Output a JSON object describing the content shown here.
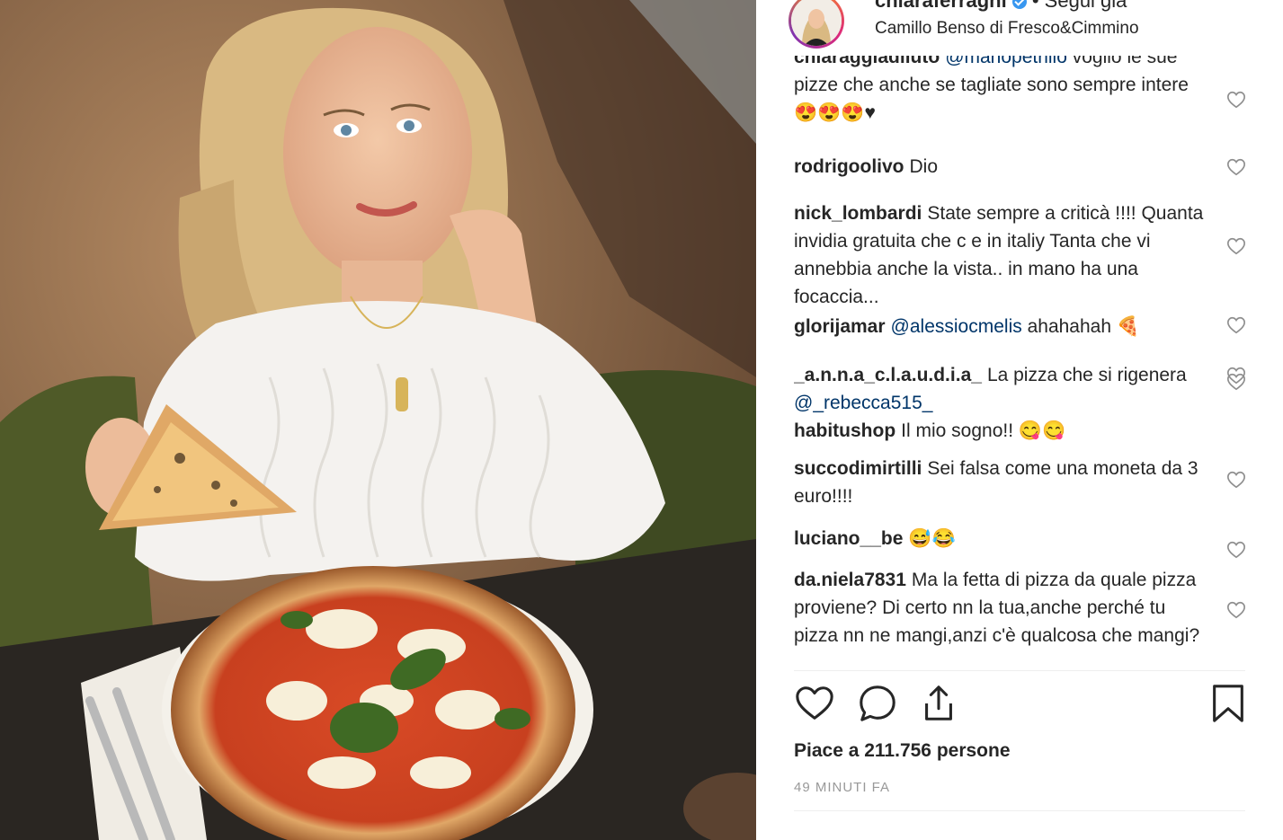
{
  "post": {
    "username": "chiaraferragni",
    "follow_label": "• Segui già",
    "location": "Camillo Benso di Fresco&Cimmino"
  },
  "comments": [
    {
      "user": "chiaraggiadiluto",
      "pre": "",
      "mention": "@manopetrillo",
      "text": " voglio le sue pizze che anche se tagliate sono sempre intere 😍😍😍♥"
    },
    {
      "user": "rodrigoolivo",
      "pre": "",
      "mention": "",
      "text": "Dio"
    },
    {
      "user": "nick_lombardi",
      "pre": "",
      "mention": "",
      "text": "State sempre a criticà !!!! Quanta invidia gratuita che c e in italiy Tanta che vi annebbia anche la vista.. in mano ha una focaccia..."
    },
    {
      "user": "glorijamar",
      "pre": "",
      "mention": "@alessiocmelis",
      "text": " ahahahah 🍕"
    },
    {
      "user": "_a.n.n.a_c.l.a.u.d.i.a_",
      "pre": "La pizza che si rigenera ",
      "mention": "@_rebecca515_",
      "text": ""
    },
    {
      "user": "habitushop",
      "pre": "",
      "mention": "",
      "text": "Il mio sogno!! 😋😋"
    },
    {
      "user": "succodimirtilli",
      "pre": "",
      "mention": "",
      "text": "Sei falsa come una moneta da 3 euro!!!!"
    },
    {
      "user": "luciano__be",
      "pre": "",
      "mention": "",
      "text": "😅😂"
    },
    {
      "user": "da.niela7831",
      "pre": "",
      "mention": "",
      "text": "Ma la fetta di pizza da quale pizza proviene? Di certo nn la tua,anche perché tu pizza nn ne mangi,anzi c'è qualcosa che mangi?"
    }
  ],
  "icons": {
    "like": "heart-icon",
    "comment": "comment-icon",
    "share": "share-icon",
    "save": "bookmark-icon"
  },
  "likes_label": "Piace a 211.756 persone",
  "time_label": "49 MINUTI FA",
  "colors": {
    "mention": "#003569",
    "verified": "#3897f0",
    "text": "#262626",
    "muted": "#999999"
  }
}
